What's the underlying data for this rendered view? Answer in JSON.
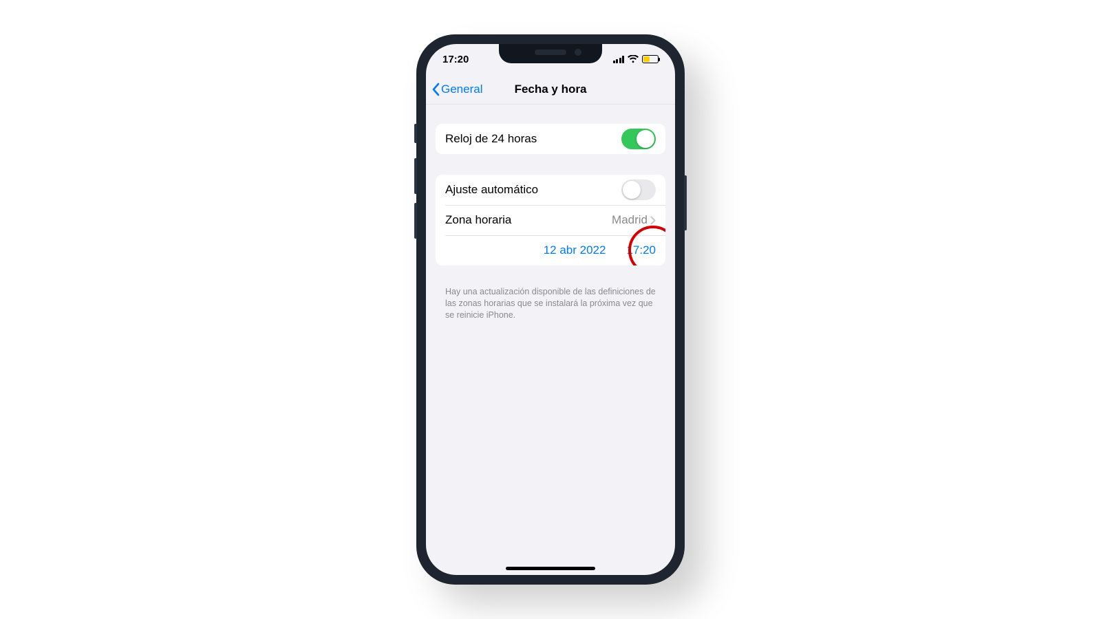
{
  "status": {
    "time": "17:20"
  },
  "nav": {
    "back": "General",
    "title": "Fecha y hora"
  },
  "group1": {
    "clock24": {
      "label": "Reloj de 24 horas",
      "on": true
    }
  },
  "group2": {
    "auto": {
      "label": "Ajuste automático",
      "on": false
    },
    "timezone": {
      "label": "Zona horaria",
      "value": "Madrid"
    },
    "date": "12 abr 2022",
    "time": "17:20"
  },
  "footer": "Hay una actualización disponible de las definiciones de las zonas horarias que se instalará la próxima vez que se reinicie iPhone."
}
